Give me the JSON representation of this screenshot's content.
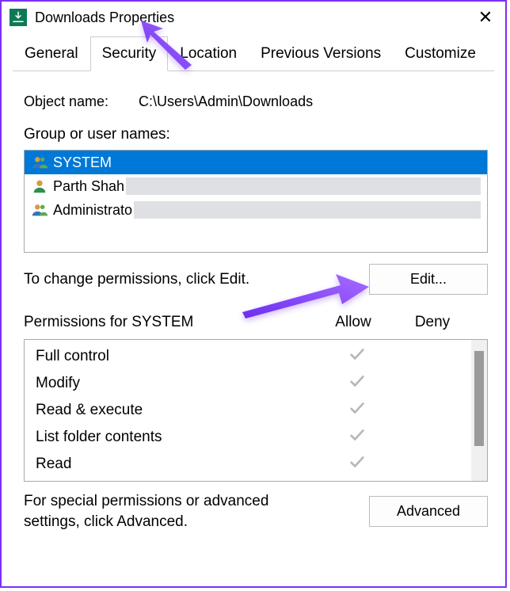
{
  "window": {
    "title": "Downloads Properties"
  },
  "tabs": [
    {
      "label": "General",
      "active": false
    },
    {
      "label": "Security",
      "active": true
    },
    {
      "label": "Location",
      "active": false
    },
    {
      "label": "Previous Versions",
      "active": false
    },
    {
      "label": "Customize",
      "active": false
    }
  ],
  "object": {
    "label": "Object name:",
    "value": "C:\\Users\\Admin\\Downloads"
  },
  "group": {
    "label": "Group or user names:",
    "items": [
      {
        "name": "SYSTEM",
        "icon": "users",
        "selected": true
      },
      {
        "name": "Parth Shah",
        "icon": "user",
        "selected": false
      },
      {
        "name": "Administrators",
        "icon": "users",
        "selected": false,
        "display": "Administrato"
      }
    ]
  },
  "edit": {
    "text": "To change permissions, click Edit.",
    "button": "Edit..."
  },
  "perm": {
    "header_label": "Permissions for SYSTEM",
    "col_allow": "Allow",
    "col_deny": "Deny",
    "rows": [
      {
        "name": "Full control",
        "allow": true,
        "deny": false
      },
      {
        "name": "Modify",
        "allow": true,
        "deny": false
      },
      {
        "name": "Read & execute",
        "allow": true,
        "deny": false
      },
      {
        "name": "List folder contents",
        "allow": true,
        "deny": false
      },
      {
        "name": "Read",
        "allow": true,
        "deny": false
      }
    ]
  },
  "advanced": {
    "text": "For special permissions or advanced settings, click Advanced.",
    "button": "Advanced"
  }
}
